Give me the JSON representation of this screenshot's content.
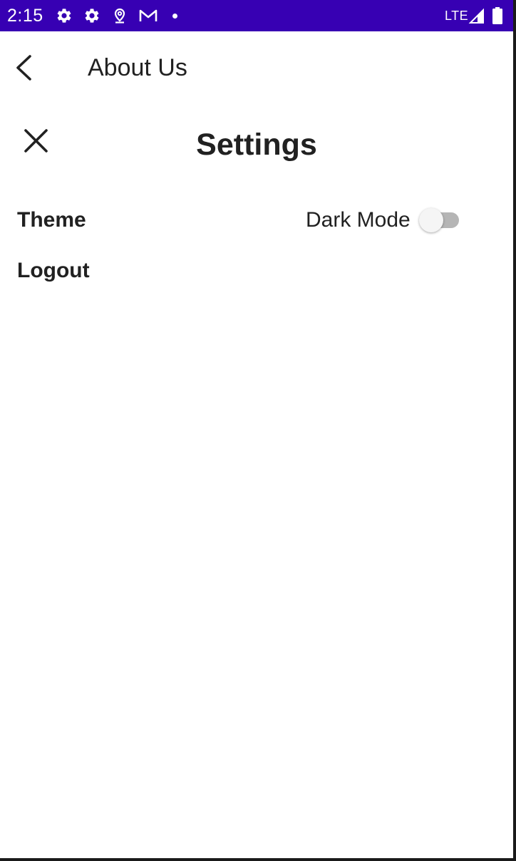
{
  "status_bar": {
    "time": "2:15",
    "network": "LTE",
    "background_color": "#3700b3",
    "icons": [
      "settings-icon",
      "settings-icon",
      "location-pin-icon",
      "gmail-icon",
      "notification-dot-icon",
      "signal-icon",
      "battery-icon"
    ]
  },
  "top_bar": {
    "back_icon": "chevron-left-icon",
    "title": "About Us"
  },
  "settings_panel": {
    "close_icon": "close-icon",
    "title": "Settings",
    "theme_label": "Theme",
    "dark_mode_label": "Dark Mode",
    "dark_mode_enabled": false,
    "logout_label": "Logout"
  }
}
